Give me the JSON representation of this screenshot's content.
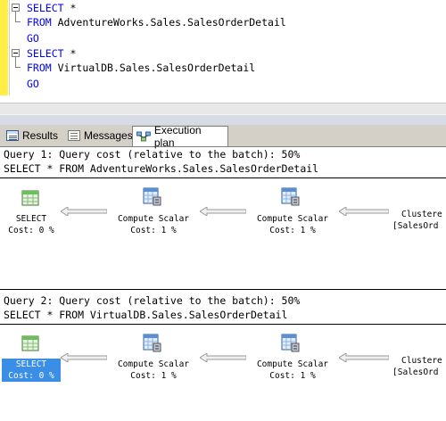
{
  "editor": {
    "lines": [
      {
        "kw": "SELECT",
        "rest": " *"
      },
      {
        "kw": "FROM",
        "rest": " AdventureWorks.Sales.SalesOrderDetail"
      },
      {
        "kw": "GO",
        "rest": ""
      },
      {
        "kw": "SELECT",
        "rest": " *"
      },
      {
        "kw": "FROM",
        "rest": " VirtualDB.Sales.SalesOrderDetail"
      },
      {
        "kw": "GO",
        "rest": ""
      }
    ]
  },
  "tabs": [
    {
      "label": "Results",
      "icon": "results-grid-icon"
    },
    {
      "label": "Messages",
      "icon": "messages-icon"
    },
    {
      "label": "Execution plan",
      "icon": "execution-plan-icon",
      "active": true
    }
  ],
  "queries": [
    {
      "header": "Query 1: Query cost (relative to the batch): 50%",
      "sql": "SELECT * FROM AdventureWorks.Sales.SalesOrderDetail",
      "nodes": [
        {
          "name": "SELECT",
          "cost": "Cost: 0 %",
          "icon": "select-icon",
          "selected": false
        },
        {
          "name": "Compute Scalar",
          "cost": "Cost: 1 %",
          "icon": "compute-scalar-icon"
        },
        {
          "name": "Compute Scalar",
          "cost": "Cost: 1 %",
          "icon": "compute-scalar-icon"
        },
        {
          "name": "Clustere",
          "cost": "[SalesOrd",
          "icon": "clustered-index-scan-icon"
        }
      ]
    },
    {
      "header": "Query 2: Query cost (relative to the batch): 50%",
      "sql": "SELECT * FROM VirtualDB.Sales.SalesOrderDetail",
      "nodes": [
        {
          "name": "SELECT",
          "cost": "Cost: 0 %",
          "icon": "select-icon",
          "selected": true
        },
        {
          "name": "Compute Scalar",
          "cost": "Cost: 1 %",
          "icon": "compute-scalar-icon"
        },
        {
          "name": "Compute Scalar",
          "cost": "Cost: 1 %",
          "icon": "compute-scalar-icon"
        },
        {
          "name": "Clustere",
          "cost": "[SalesOrd",
          "icon": "clustered-index-scan-icon"
        }
      ]
    }
  ],
  "colors": {
    "keyword": "#0000ff",
    "gutter": "#ffee44",
    "selection": "#3a8ee6"
  }
}
